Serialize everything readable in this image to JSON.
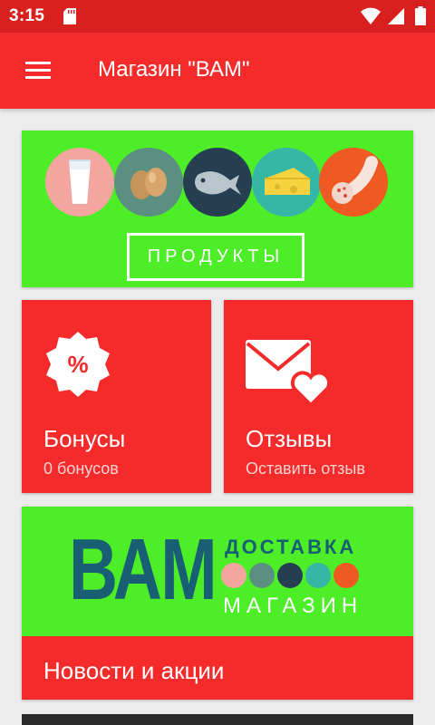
{
  "status_bar": {
    "time": "3:15",
    "icons": [
      "sd-card-icon",
      "wifi-icon",
      "cell-signal-icon",
      "battery-icon"
    ]
  },
  "app_bar": {
    "menu_icon": "hamburger-menu-icon",
    "title": "Магазин \"ВАМ\""
  },
  "products_card": {
    "button_label": "ПРОДУКТЫ",
    "icons": [
      "milk-icon",
      "eggs-icon",
      "fish-icon",
      "cheese-icon",
      "sausage-icon"
    ]
  },
  "bonus_card": {
    "icon": "percent-badge-icon",
    "title": "Бонусы",
    "subtitle": "0 бонусов"
  },
  "reviews_card": {
    "icon": "envelope-heart-icon",
    "title": "Отзывы",
    "subtitle": "Оставить отзыв"
  },
  "news_card": {
    "banner": {
      "logo_text": "ВАМ",
      "tagline_top": "ДОСТАВКА",
      "tagline_bottom": "МАГАЗИН"
    },
    "title": "Новости и акции"
  },
  "colors": {
    "status_bar": "#d8201f",
    "accent_red": "#f52a2a",
    "accent_green": "#4ded28",
    "logo_teal": "#185f73",
    "background": "#ececec"
  }
}
